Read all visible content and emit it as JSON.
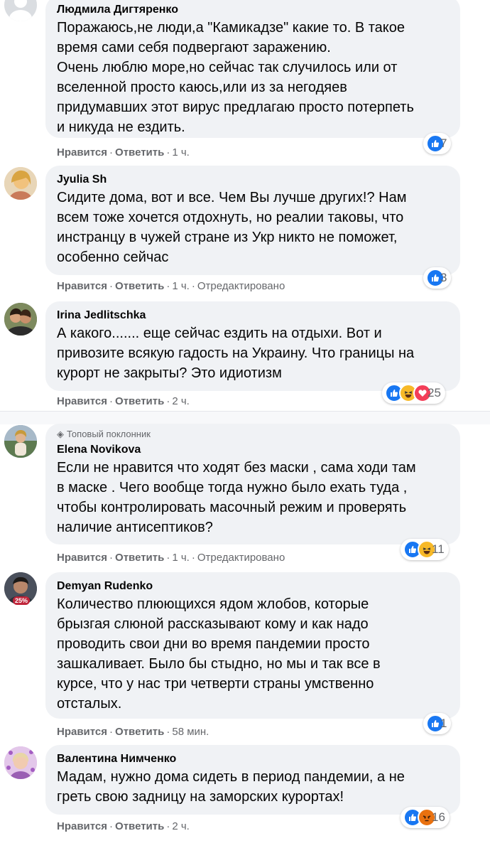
{
  "ui": {
    "like_label": "Нравится",
    "reply_label": "Ответить",
    "dot": "·",
    "edited_label": "Отредактировано"
  },
  "comments": [
    {
      "author": "Людмила Дигтяренко",
      "text": "Поражаюсь,не люди,а \"Камикадзе\" какие то. В такое\nвремя сами себя подвергают заражению.\nОчень люблю море,но сейчас так случилось или от\nвселенной просто каюсь,или из за негодяев\nпридумавших этот вирус предлагаю просто потерпеть\nи никуда не ездить.",
      "time": "1 ч.",
      "reactions": [
        "like"
      ],
      "reaction_count": "7"
    },
    {
      "author": "Jyulia Sh",
      "text": "Сидите дома, вот и все. Чем Вы лучше других!? Нам\nвсем тоже хочется отдохнуть, но реалии таковы, что\nинстранцу в чужей стране из Укр никто не поможет,\nособенно сейчас",
      "time": "1 ч.",
      "edited": true,
      "reactions": [
        "like"
      ],
      "reaction_count": "3"
    },
    {
      "author": "Irina Jedlitschka",
      "text": "А какого....... еще сейчас ездить на отдыхи. Вот и\nпривозите всякую гадость на Украину. Что границы на\nкурорт не закрыты? Это идиотизм",
      "time": "2 ч.",
      "reactions": [
        "like",
        "haha",
        "love"
      ],
      "reaction_count": "25"
    },
    {
      "badge": "Топовый поклонник",
      "author": "Elena Novikova",
      "text": "Если не нравится что ходят без маски , сама ходи там\nв маске . Чего вообще тогда нужно было ехать туда ,\nчтобы контролировать масочный режим и проверять\nналичие антисептиков?",
      "time": "1 ч.",
      "edited": true,
      "reactions": [
        "like",
        "haha"
      ],
      "reaction_count": "11"
    },
    {
      "author": "Demyan Rudenko",
      "avatar_badge": "25%",
      "text": "Количество плюющихся ядом жлобов, которые\nбрызгая слюной рассказывают кому и как надо\nпроводить свои дни во время пандемии просто\nзашкаливает. Было бы стыдно, но мы и так все в\nкурсе, что у нас три четверти страны умственно\nотсталых.",
      "time": "58 мин.",
      "reactions": [
        "like"
      ],
      "reaction_count": "1"
    },
    {
      "author": "Валентина Нимченко",
      "text": "Мадам, нужно дома сидеть в период пандемии, а не\nгреть свою задницу на заморских курортах!",
      "time": "2 ч.",
      "reactions": [
        "like",
        "angry"
      ],
      "reaction_count": "16"
    }
  ]
}
